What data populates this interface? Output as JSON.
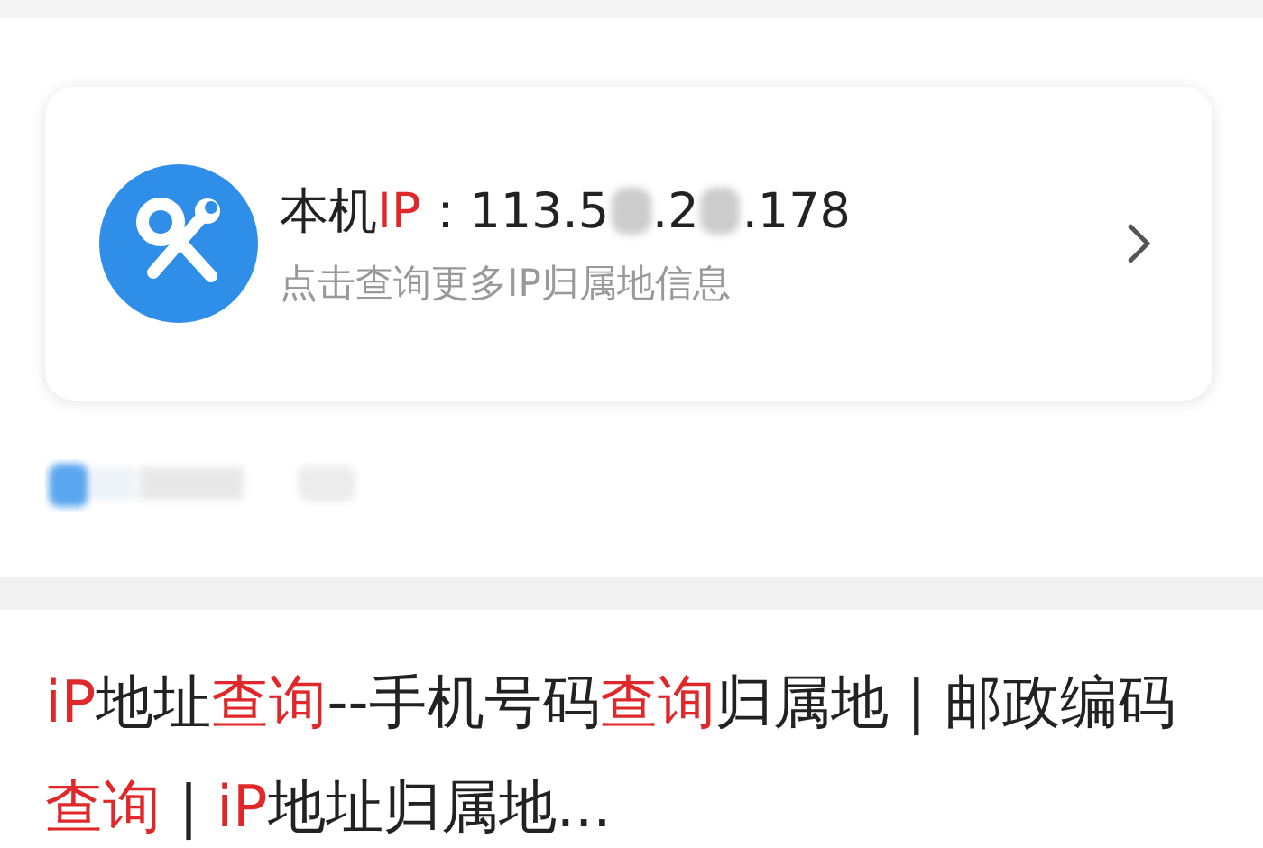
{
  "ip_card": {
    "label_segments": [
      {
        "text": "本机",
        "highlight": false
      },
      {
        "text": "IP",
        "highlight": true
      },
      {
        "text": "：",
        "highlight": false
      }
    ],
    "ip_parts": [
      {
        "kind": "text",
        "text": "113.5"
      },
      {
        "kind": "masked"
      },
      {
        "kind": "text",
        "text": ".2"
      },
      {
        "kind": "masked"
      },
      {
        "kind": "text",
        "text": ".178"
      }
    ],
    "subtitle": "点击查询更多IP归属地信息"
  },
  "result": {
    "title_segments": [
      {
        "text": "iP",
        "highlight": true
      },
      {
        "text": "地址",
        "highlight": false
      },
      {
        "text": "查询",
        "highlight": true
      },
      {
        "text": "--手机号码",
        "highlight": false
      },
      {
        "text": "查询",
        "highlight": true
      },
      {
        "text": "归属地 | 邮政编码",
        "highlight": false
      },
      {
        "text": "查询",
        "highlight": true
      },
      {
        "text": " | ",
        "highlight": false
      },
      {
        "text": "iP",
        "highlight": true
      },
      {
        "text": "地址归属地...",
        "highlight": false
      }
    ]
  }
}
